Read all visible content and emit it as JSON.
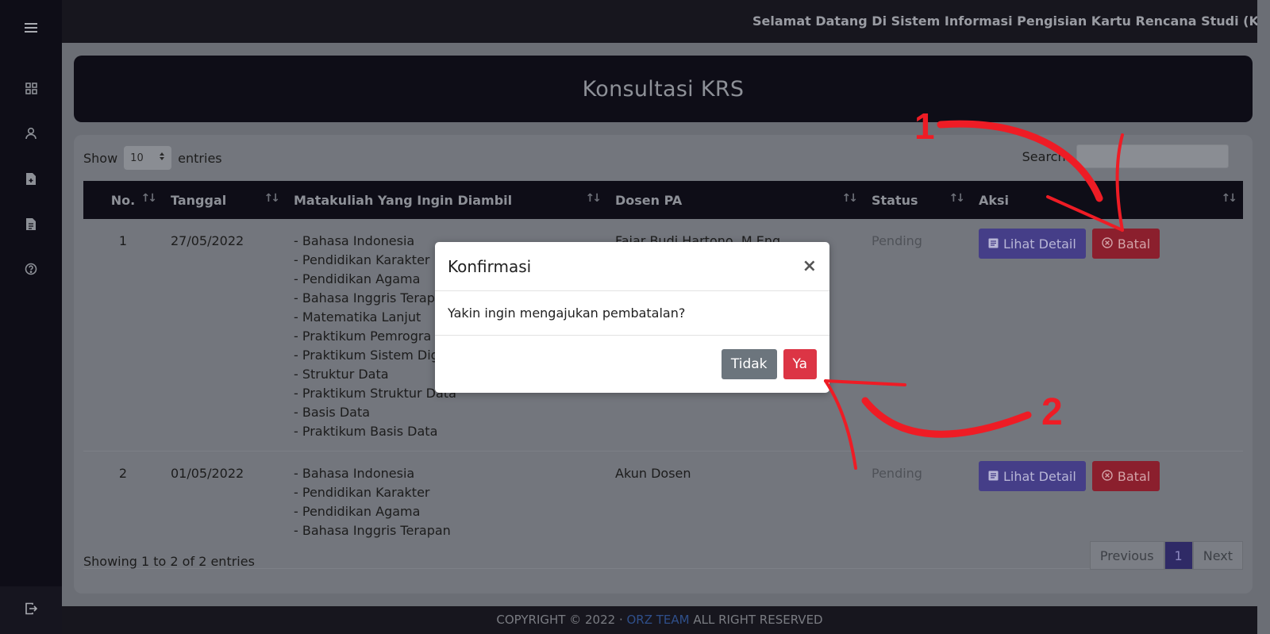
{
  "topbar": {
    "marquee": "Selamat Datang Di Sistem Informasi Pengisian Kartu Rencana Studi (KRS) Berbo"
  },
  "page": {
    "title": "Konsultasi KRS"
  },
  "table_controls": {
    "show_label": "Show",
    "entries_value": "10",
    "entries_label": "entries",
    "search_label": "Search:"
  },
  "table": {
    "headers": [
      "No.",
      "Tanggal",
      "Matakuliah Yang Ingin Diambil",
      "Dosen PA",
      "Status",
      "Aksi"
    ],
    "rows": [
      {
        "no": "1",
        "tanggal": "27/05/2022",
        "matakuliah": [
          "- Bahasa Indonesia",
          "- Pendidikan Karakter",
          "- Pendidikan Agama",
          "- Bahasa Inggris Terap",
          "- Matematika Lanjut",
          "- Praktikum Pemrogra",
          "- Praktikum Sistem Dig",
          "- Struktur Data",
          "- Praktikum Struktur Data",
          "- Basis Data",
          "- Praktikum Basis Data"
        ],
        "dosen": "Fajar Budi Hartono, M.Eng",
        "status": "Pending"
      },
      {
        "no": "2",
        "tanggal": "01/05/2022",
        "matakuliah": [
          "- Bahasa Indonesia",
          "- Pendidikan Karakter",
          "- Pendidikan Agama",
          "- Bahasa Inggris Terapan"
        ],
        "dosen": "Akun Dosen",
        "status": "Pending"
      }
    ],
    "detail_label": "Lihat Detail",
    "batal_label": "Batal"
  },
  "table_info": "Showing 1 to 2 of 2 entries",
  "pagination": {
    "previous": "Previous",
    "current": "1",
    "next": "Next"
  },
  "footer": {
    "prefix": "COPYRIGHT © 2022 · ",
    "team": "ORZ TEAM",
    "suffix": " ALL RIGHT RESERVED"
  },
  "modal": {
    "title": "Konfirmasi",
    "close": "×",
    "message": "Yakin ingin mengajukan pembatalan?",
    "no_label": "Tidak",
    "yes_label": "Ya"
  },
  "annotations": {
    "step1": "1",
    "step2": "2"
  },
  "colors": {
    "sidebar": "#0e0d17",
    "accent_detail": "#453e88",
    "accent_danger": "#dc3545",
    "annotation": "#ee1c25"
  },
  "icons": {
    "sidebar": [
      "menu-icon",
      "dashboard-icon",
      "user-icon",
      "file-add-icon",
      "document-icon",
      "help-icon"
    ],
    "logout": "logout-icon"
  }
}
